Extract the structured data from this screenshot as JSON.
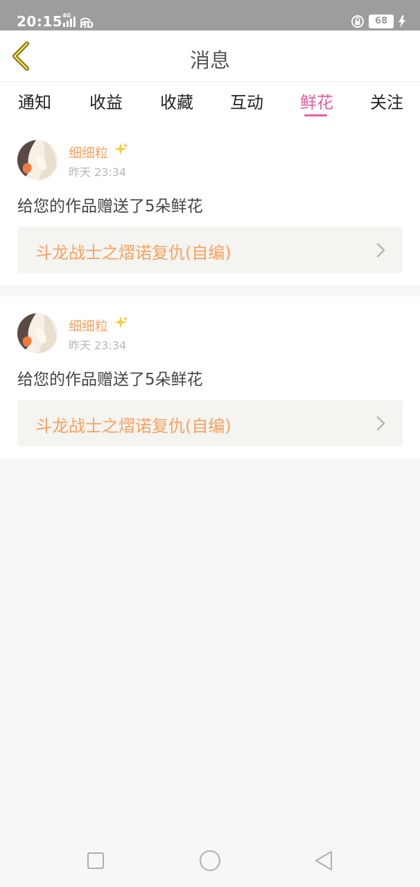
{
  "status_bar": {
    "time": "20:15",
    "network": "4G",
    "hd": "HD",
    "battery": "68"
  },
  "header": {
    "title": "消息"
  },
  "tabs": [
    {
      "label": "通知"
    },
    {
      "label": "收益"
    },
    {
      "label": "收藏"
    },
    {
      "label": "互动"
    },
    {
      "label": "鲜花",
      "active": true
    },
    {
      "label": "关注"
    }
  ],
  "notifications": [
    {
      "user": "细细粒",
      "time": "昨天 23:34",
      "message": "给您的作品赠送了5朵鲜花",
      "work": "斗龙战士之熠诺复仇(自编)"
    },
    {
      "user": "细细粒",
      "time": "昨天 23:34",
      "message": "给您的作品赠送了5朵鲜花",
      "work": "斗龙战士之熠诺复仇(自编)"
    }
  ],
  "colors": {
    "accent_pink": "#e45ea3",
    "accent_orange": "#f4a261",
    "status_bar": "#9d9d9d"
  },
  "icons": {
    "back": "back-chevron-icon",
    "sparkle": "sparkle-icon",
    "item_chevron": "chevron-right-icon",
    "nav_recent": "square-icon",
    "nav_home": "circle-icon",
    "nav_back": "triangle-back-icon"
  }
}
